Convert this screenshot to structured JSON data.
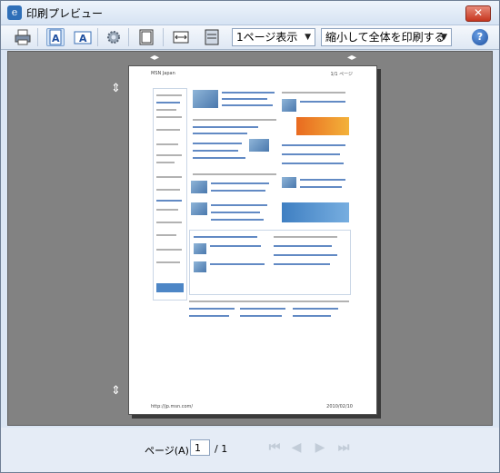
{
  "window": {
    "title": "印刷プレビュー"
  },
  "toolbar": {
    "pages_per_view": "1ページ表示",
    "scale": "縮小して全体を印刷する"
  },
  "page": {
    "header_left": "MSN Japan",
    "header_right": "1/1 ページ",
    "footer_left": "http://jp.msn.com/",
    "footer_right": "2010/02/10"
  },
  "footer": {
    "page_label": "ページ(A)",
    "page_value": "1",
    "page_total": "/ 1"
  },
  "icons": [
    "print-icon",
    "portrait-icon",
    "landscape-icon",
    "settings-icon",
    "header-footer-icon",
    "full-width-icon",
    "full-page-icon",
    "help-icon"
  ]
}
